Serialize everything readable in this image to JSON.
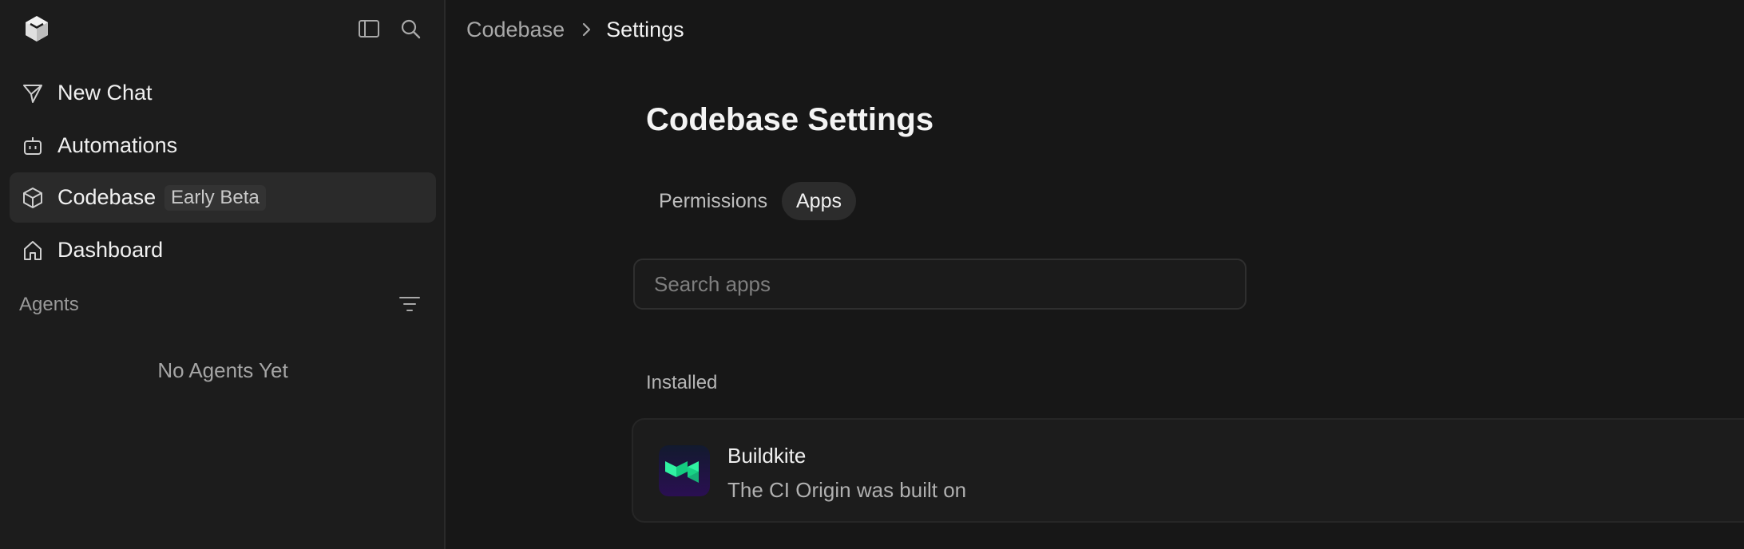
{
  "sidebar": {
    "logo_icon": "cube-logo-icon",
    "toggle_icon": "sidebar-toggle-icon",
    "search_icon": "search-icon",
    "items": [
      {
        "label": "New Chat",
        "icon": "paper-plane-icon"
      },
      {
        "label": "Automations",
        "icon": "robot-icon"
      },
      {
        "label": "Codebase",
        "icon": "cube-icon",
        "badge": "Early Beta",
        "active": true
      },
      {
        "label": "Dashboard",
        "icon": "home-icon"
      }
    ],
    "agents_section": {
      "label": "Agents",
      "filter_icon": "filter-icon",
      "empty_text": "No Agents Yet"
    }
  },
  "breadcrumb": {
    "parent": "Codebase",
    "current": "Settings"
  },
  "main": {
    "title": "Codebase Settings",
    "tabs": [
      {
        "label": "Permissions",
        "active": false
      },
      {
        "label": "Apps",
        "active": true
      }
    ],
    "search": {
      "placeholder": "Search apps",
      "value": ""
    },
    "installed_label": "Installed",
    "apps": [
      {
        "name": "Buildkite",
        "description": "The CI Origin was built on",
        "icon": "buildkite-logo-icon"
      }
    ]
  },
  "colors": {
    "background": "#171717",
    "sidebar": "#1c1c1c",
    "active_item": "#2a2a2a",
    "buildkite_green": "#30f2a2"
  }
}
